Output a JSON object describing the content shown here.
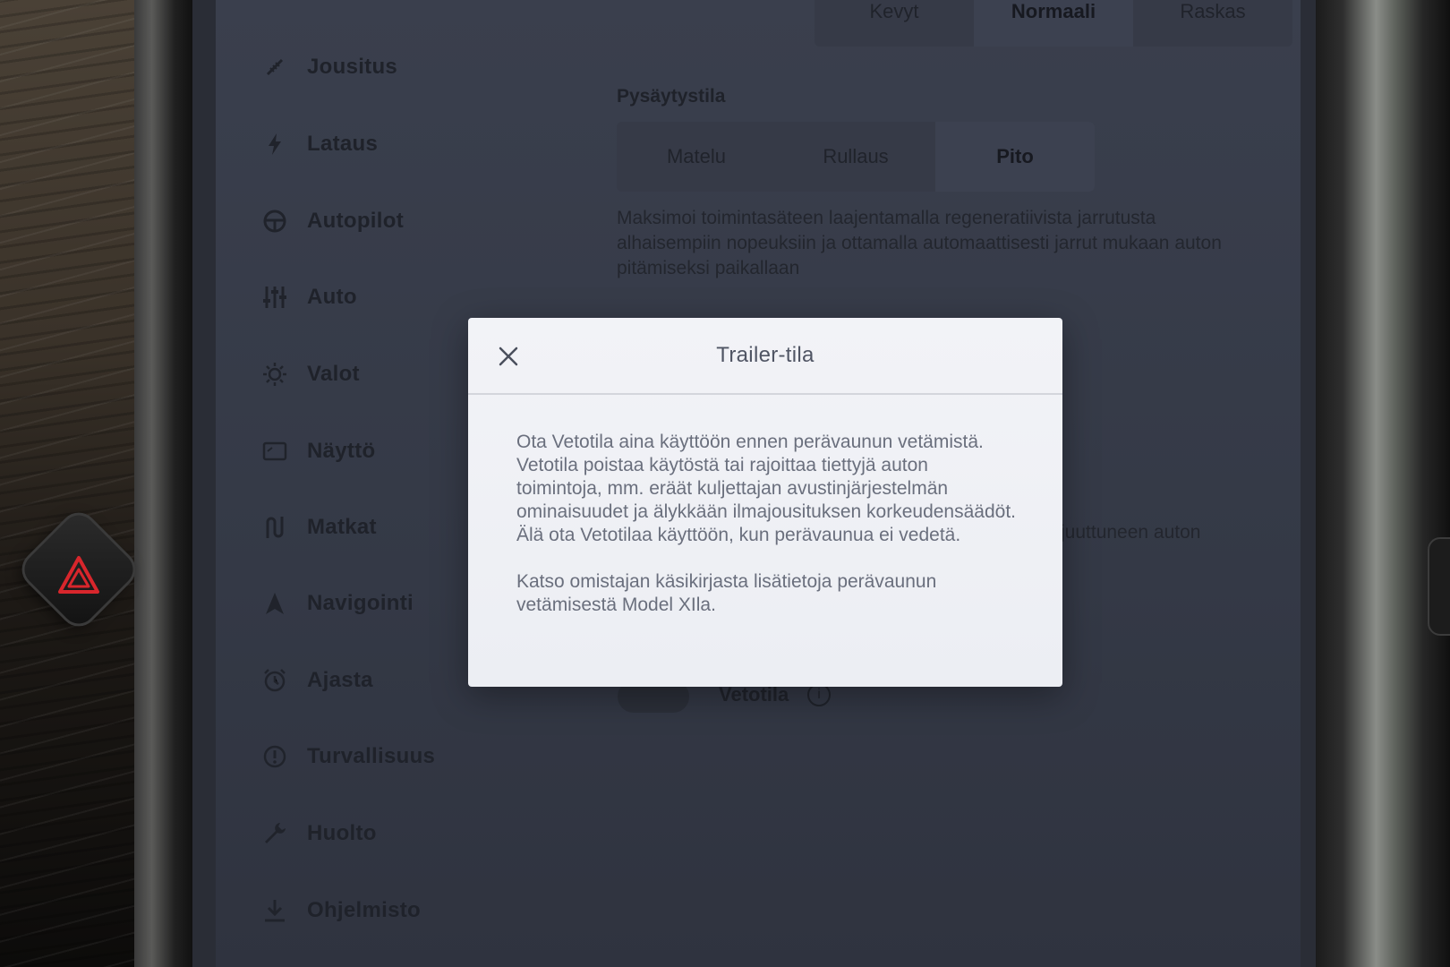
{
  "sidebar": {
    "items": [
      {
        "label": "Jousitus",
        "icon": "suspension-icon"
      },
      {
        "label": "Lataus",
        "icon": "lightning-icon"
      },
      {
        "label": "Autopilot",
        "icon": "steering-wheel-icon"
      },
      {
        "label": "Auto",
        "icon": "sliders-icon"
      },
      {
        "label": "Valot",
        "icon": "sun-icon"
      },
      {
        "label": "Näyttö",
        "icon": "display-icon"
      },
      {
        "label": "Matkat",
        "icon": "trips-icon"
      },
      {
        "label": "Navigointi",
        "icon": "navigation-arrow-icon"
      },
      {
        "label": "Ajasta",
        "icon": "alarm-clock-icon"
      },
      {
        "label": "Turvallisuus",
        "icon": "alert-circle-icon"
      },
      {
        "label": "Huolto",
        "icon": "wrench-icon"
      },
      {
        "label": "Ohjelmisto",
        "icon": "download-icon"
      }
    ]
  },
  "main": {
    "regen_options": [
      "Kevyt",
      "Normaali",
      "Raskas"
    ],
    "regen_selected": "Normaali",
    "stopping_mode": {
      "label": "Pysäytystila",
      "options": [
        "Matelu",
        "Rullaus",
        "Pito"
      ],
      "selected": "Pito",
      "description": "Maksimoi toimintasäteen laajentamalla regeneratiivista jarrutusta alhaisempiin nopeuksiin ja ottamalla automaattisesti jarrut mukaan auton pitämiseksi paikallaan"
    },
    "obscured_text_fragment": "juuttuneen auton",
    "towing_toggle_label": "Vetotila",
    "towing_info_icon": "i"
  },
  "modal": {
    "title": "Trailer-tila",
    "paragraphs": [
      "Ota Vetotila aina käyttöön ennen perävaunun vetämistä. Vetotila poistaa käytöstä tai rajoittaa tiettyjä auton toimintoja, mm. eräät kuljettajan avustinjärjestelmän ominaisuudet ja älykkään ilmajousituksen korkeudensäädöt. Älä ota Vetotilaa käyttöön, kun perävaunua ei vedetä.",
      "Katso omistajan käsikirjasta lisätietoja perävaunun vetämisestä Model XIla."
    ]
  },
  "colors": {
    "hazard": "#d8262c",
    "screen_bg": "#363a47",
    "modal_bg": "#f0f1f5"
  }
}
